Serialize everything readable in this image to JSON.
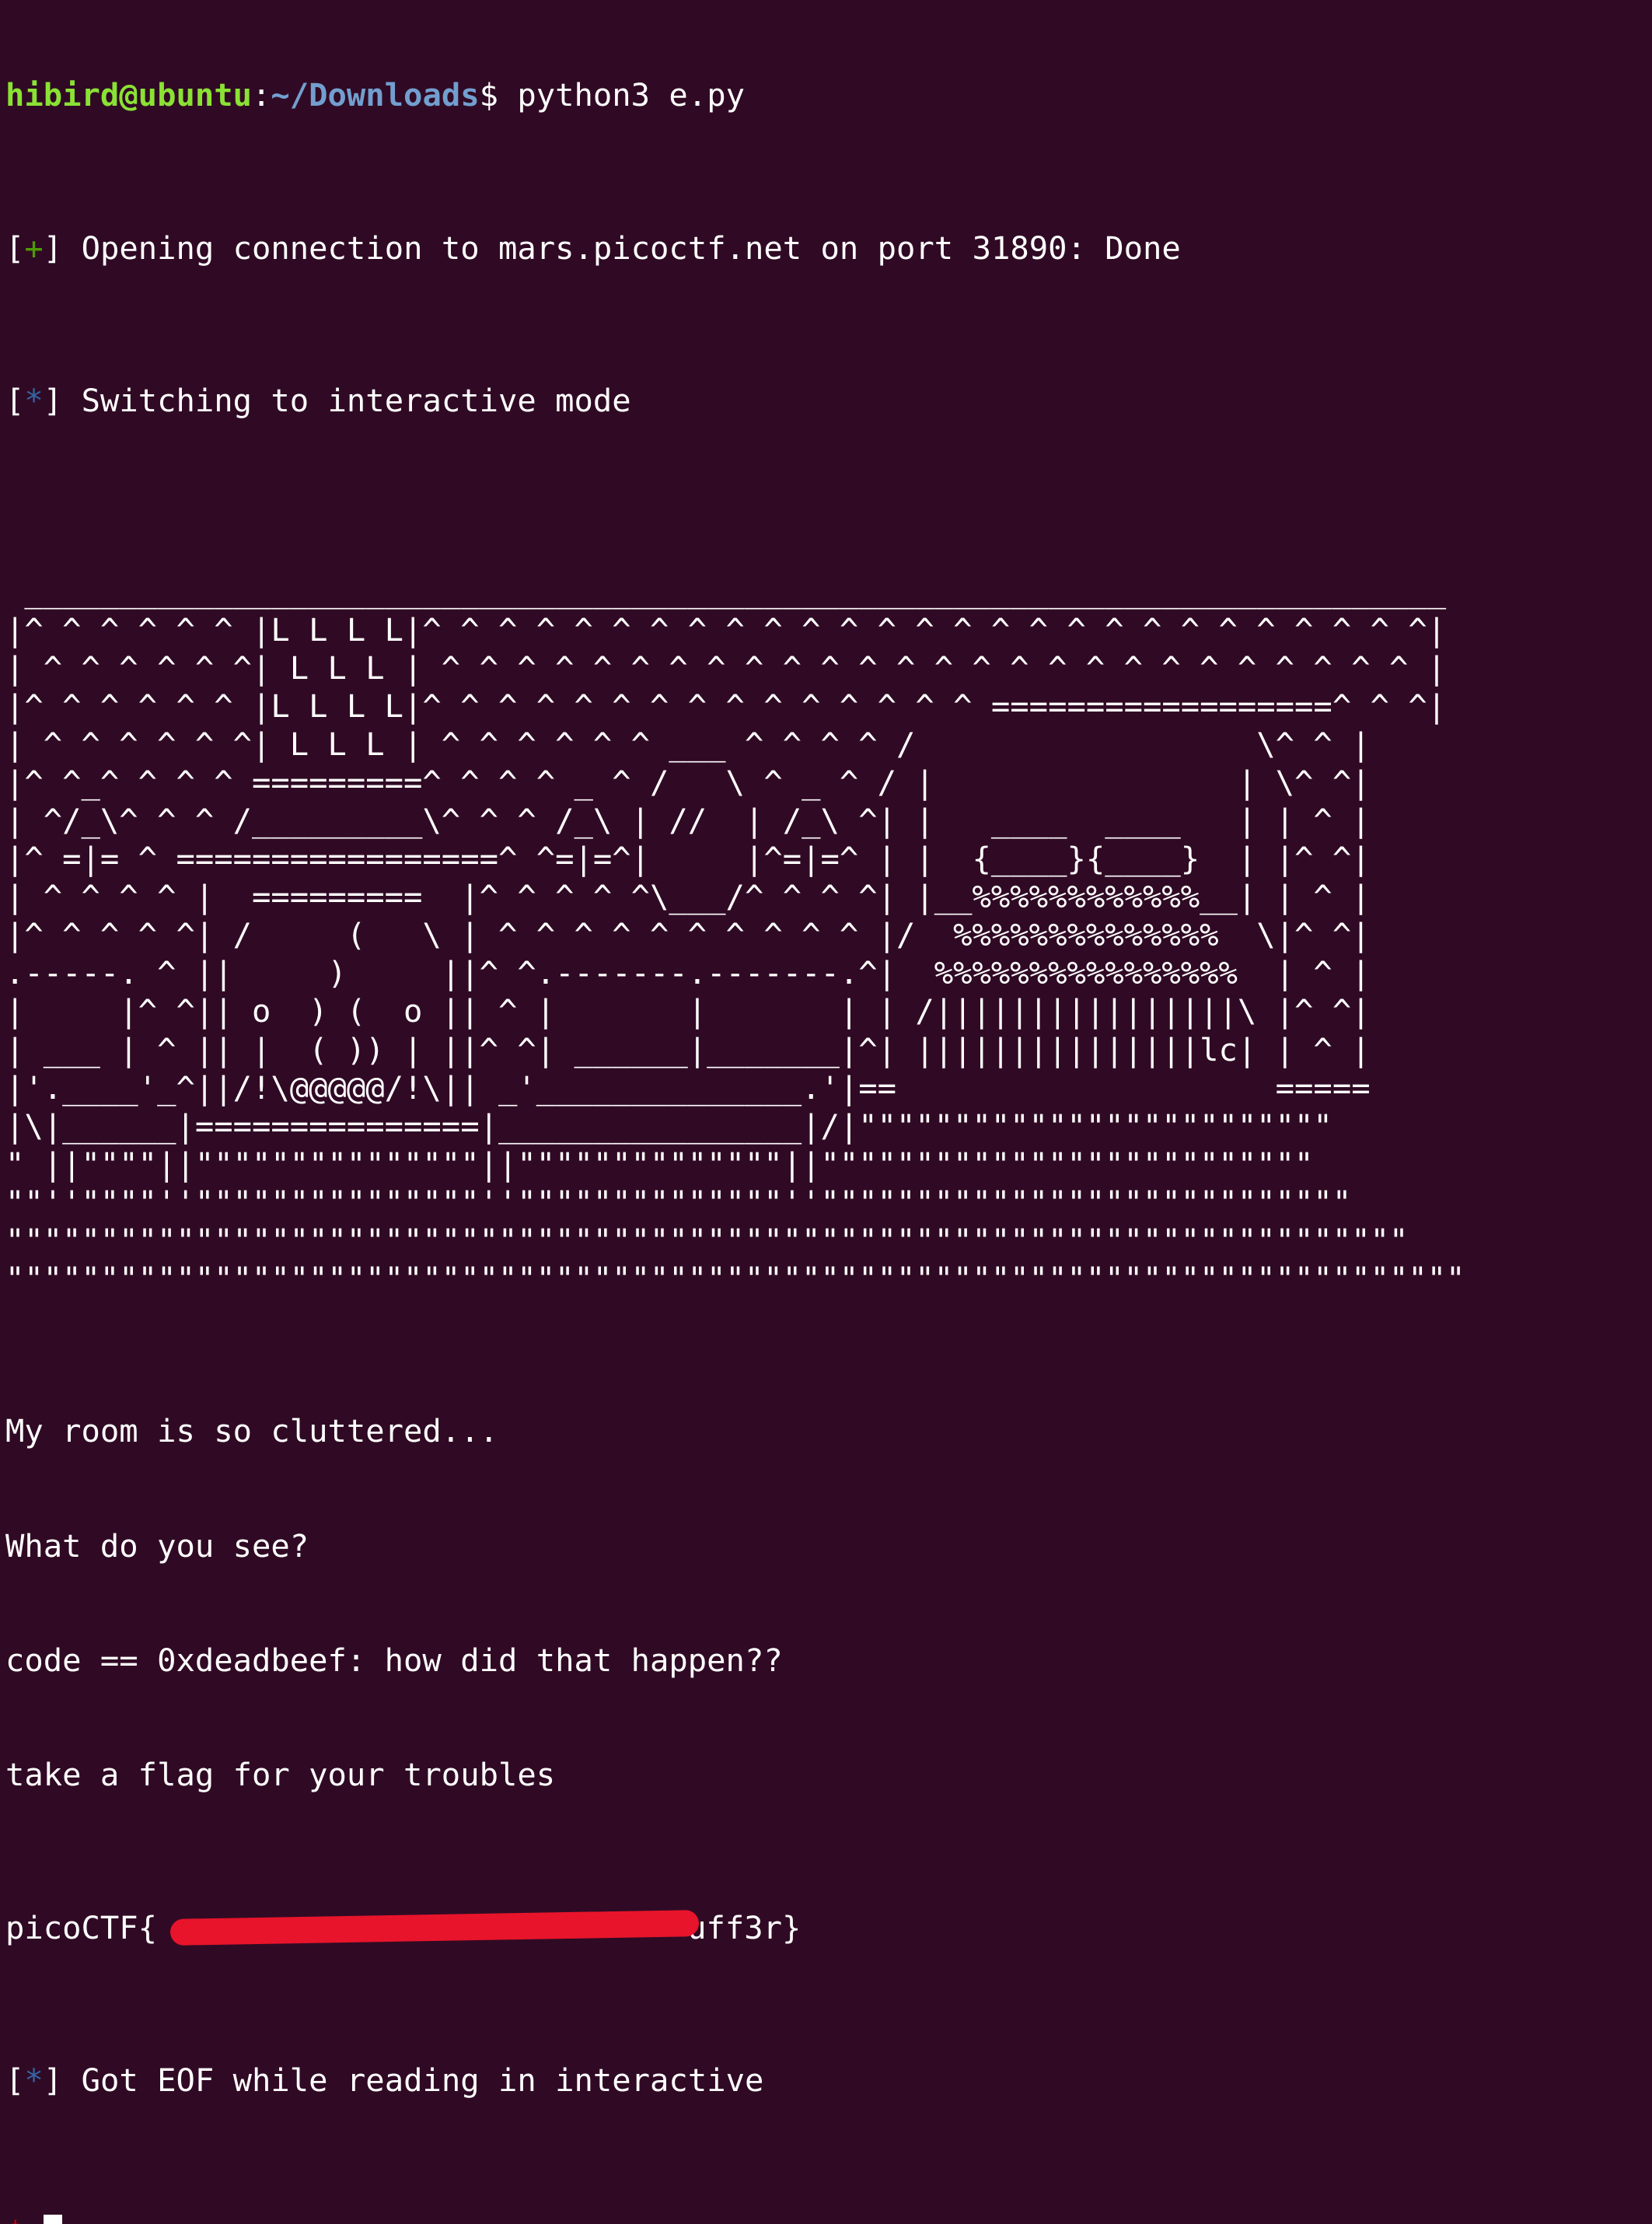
{
  "terminal": {
    "prompt": {
      "user_host": "hibird@ubuntu",
      "colon": ":",
      "path": "~/Downloads",
      "dollar": "$",
      "command": " python3 e.py"
    },
    "pwn_lines": [
      {
        "open": "[",
        "sym": "+",
        "close": "] ",
        "text": "Opening connection to mars.picoctf.net on port 31890: Done"
      },
      {
        "open": "[",
        "sym": "*",
        "close": "] ",
        "text": "Switching to interactive mode"
      }
    ],
    "art_lines": [
      "",
      " ___________________________________________________________________________",
      "|^ ^ ^ ^ ^ ^ |L L L L|^ ^ ^ ^ ^ ^ ^ ^ ^ ^ ^ ^ ^ ^ ^ ^ ^ ^ ^ ^ ^ ^ ^ ^ ^ ^ ^|",
      "| ^ ^ ^ ^ ^ ^| L L L | ^ ^ ^ ^ ^ ^ ^ ^ ^ ^ ^ ^ ^ ^ ^ ^ ^ ^ ^ ^ ^ ^ ^ ^ ^ ^ |",
      "|^ ^ ^ ^ ^ ^ |L L L L|^ ^ ^ ^ ^ ^ ^ ^ ^ ^ ^ ^ ^ ^ ^ ==================^ ^ ^|",
      "| ^ ^ ^ ^ ^ ^| L L L | ^ ^ ^ ^ ^ ^ ___ ^ ^ ^ ^ /                  \\^ ^ |",
      "|^ ^_^ ^ ^ ^ =========^ ^ ^ ^ _ ^ /   \\ ^ _ ^ / |                | \\^ ^|",
      "| ^/_\\^ ^ ^ /_________\\^ ^ ^ /_\\ | //  | /_\\ ^| |   ____  ____   | | ^ |",
      "|^ =|= ^ =================^ ^=|=^|     |^=|=^ | |  {____}{____}  | |^ ^|",
      "| ^ ^ ^ ^ |  =========  |^ ^ ^ ^ ^\\___/^ ^ ^ ^| |__%%%%%%%%%%%%__| | ^ |",
      "|^ ^ ^ ^ ^| /     (   \\ | ^ ^ ^ ^ ^ ^ ^ ^ ^ ^ |/  %%%%%%%%%%%%%%  \\|^ ^|",
      ".-----. ^ ||     )     ||^ ^.-------.-------.^|  %%%%%%%%%%%%%%%%  | ^ |",
      "|     |^ ^|| o  ) (  o || ^ |       |       | | /||||||||||||||||\\ |^ ^|",
      "| ___ | ^ || |  ( )) | ||^ ^| ______|_______|^| |||||||||||||||lc| | ^ |",
      "|'.____'_^||/!\\@@@@@/!\\|| _'______________.'|==                    =====",
      "|\\|______|===============|________________|/|\"\"\"\"\"\"\"\"\"\"\"\"\"\"\"\"\"\"\"\"\"\"\"\"\"",
      "\" ||\"\"\"\"||\"\"\"\"\"\"\"\"\"\"\"\"\"\"\"||\"\"\"\"\"\"\"\"\"\"\"\"\"\"||\"\"\"\"\"\"\"\"\"\"\"\"\"\"\"\"\"\"\"\"\"\"\"\"\"\"",
      "\"\"''\"\"\"\"''\"\"\"\"\"\"\"\"\"\"\"\"\"\"\"''\"\"\"\"\"\"\"\"\"\"\"\"\"\"''\"\"\"\"\"\"\"\"\"\"\"\"\"\"\"\"\"\"\"\"\"\"\"\"\"\"\"\"",
      "\"\"\"\"\"\"\"\"\"\"\"\"\"\"\"\"\"\"\"\"\"\"\"\"\"\"\"\"\"\"\"\"\"\"\"\"\"\"\"\"\"\"\"\"\"\"\"\"\"\"\"\"\"\"\"\"\"\"\"\"\"\"\"\"\"\"\"\"\"\"\"\"\"\"",
      "\"\"\"\"\"\"\"\"\"\"\"\"\"\"\"\"\"\"\"\"\"\"\"\"\"\"\"\"\"\"\"\"\"\"\"\"\"\"\"\"\"\"\"\"\"\"\"\"\"\"\"\"\"\"\"\"\"\"\"\"\"\"\"\"\"\"\"\"\"\"\"\"\"\"\"\"\""
    ],
    "output_lines": [
      "My room is so cluttered...",
      "What do you see?",
      "code == 0xdeadbeef: how did that happen??",
      "take a flag for your troubles"
    ],
    "flag": {
      "prefix": "picoCTF{",
      "visible_suffix": "uff3r}",
      "redacted": true,
      "redaction_color": "#e8142b"
    },
    "eof_line": {
      "open": "[",
      "sym": "*",
      "close": "] ",
      "text": "Got EOF while reading in interactive"
    },
    "final_prompt": "$",
    "colors": {
      "background": "#300a24",
      "foreground": "#ffffff",
      "user_host": "#8ae234",
      "path": "#729fcf",
      "plus": "#4e9a06",
      "star": "#3465a4",
      "final_dollar": "#cc0000"
    }
  }
}
